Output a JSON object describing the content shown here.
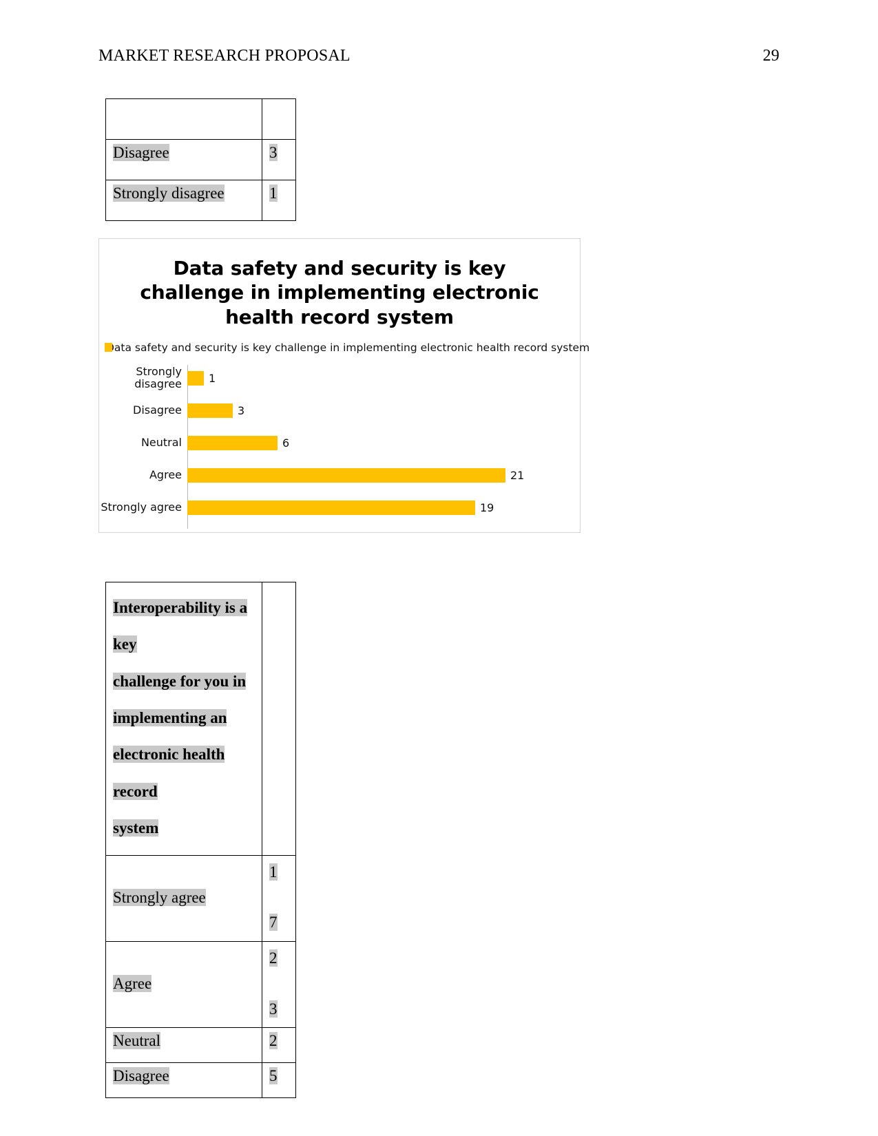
{
  "header": {
    "title": "MARKET RESEARCH PROPOSAL",
    "page_number": "29"
  },
  "table_one": {
    "header_row": [
      "",
      ""
    ],
    "rows": [
      {
        "label": "Disagree",
        "value": "3"
      },
      {
        "label": "Strongly disagree",
        "value": "1"
      }
    ]
  },
  "chart_data": {
    "type": "bar",
    "orientation": "horizontal",
    "title": "Data safety and security is key challenge in implementing electronic health record system",
    "title_lines": [
      "Data safety and security is key",
      "challenge in implementing electronic",
      "health record system"
    ],
    "legend": [
      "Data safety and security is key challenge in implementing electronic health record system"
    ],
    "legend_position": "top",
    "series_color": "#FFC000",
    "categories": [
      "Strongly disagree",
      "Disagree",
      "Neutral",
      "Agree",
      "Strongly agree"
    ],
    "category_lines": [
      [
        "Strongly",
        "disagree"
      ],
      [
        "Disagree"
      ],
      [
        "Neutral"
      ],
      [
        "Agree"
      ],
      [
        "Strongly agree"
      ]
    ],
    "values": [
      1,
      3,
      6,
      21,
      19
    ],
    "value_labels": [
      "1",
      "3",
      "6",
      "21",
      "19"
    ],
    "xlabel": "",
    "ylabel": "",
    "xlim": [
      0,
      21
    ],
    "grid": false
  },
  "table_two": {
    "question": "Interoperability is a key challenge for you in implementing an electronic health record system",
    "question_lines": [
      "Interoperability is a key",
      "challenge for you in",
      "implementing an",
      "electronic health record",
      "system"
    ],
    "rows": [
      {
        "label": "Strongly agree",
        "value": "17",
        "value_lines": [
          "1",
          "7"
        ]
      },
      {
        "label": "Agree",
        "value": "23",
        "value_lines": [
          "2",
          "3"
        ]
      },
      {
        "label": "Neutral",
        "value": "2",
        "value_lines": [
          "2"
        ]
      },
      {
        "label": "Disagree",
        "value": "5",
        "value_lines": [
          "5"
        ]
      }
    ]
  }
}
